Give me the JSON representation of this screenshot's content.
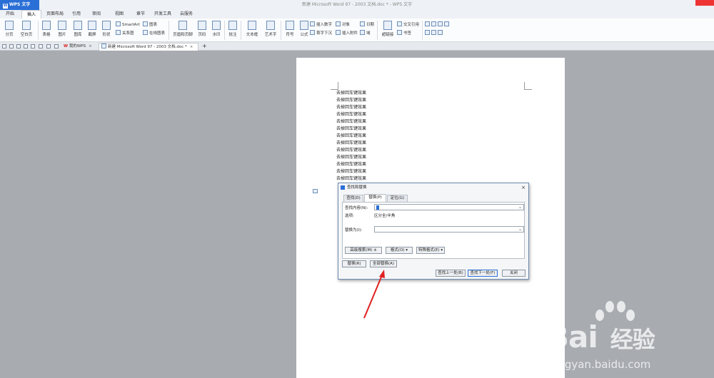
{
  "title_bar": {
    "app_label": "WPS 文字",
    "document_title": "新建 Microsoft Word 97 - 2003 文档.doc * - WPS 文字"
  },
  "menu_tabs": [
    "开始",
    "插入",
    "页面布局",
    "引用",
    "审阅",
    "视图",
    "章节",
    "开发工具",
    "云服务"
  ],
  "active_menu_tab": "插入",
  "ribbon": {
    "page_break": "分页",
    "blank_page": "空白页",
    "table": "表格",
    "picture": "图片",
    "gallery": "图库",
    "screenshot": "截屏",
    "shape": "形状",
    "smartart": "SmartArt",
    "chart": "图表",
    "relation_graph": "关系图",
    "online_chart": "在线图表",
    "header_footer": "页眉和页脚",
    "page_number": "页码",
    "watermark": "水印",
    "comment": "批注",
    "textbox": "文本框",
    "wordart": "艺术字",
    "symbol": "符号",
    "formula": "公式",
    "insert_number": "插入数字",
    "object": "对象",
    "drop_cap": "首字下沉",
    "attachment": "插入附件",
    "field": "域",
    "date": "日期",
    "hyperlink": "超链接",
    "cross_ref": "交叉引用",
    "bookmark": "书签"
  },
  "doc_tabs": {
    "my_wps": "我的WPS",
    "document": "新建 Microsoft Word 97 - 2003 文档.doc *",
    "close_glyph": "×",
    "add_glyph": "+"
  },
  "document": {
    "lines": [
      "去掉回车键效果",
      "去掉回车键效果",
      "去掉回车键效果",
      "去掉回车键效果",
      "去掉回车键效果",
      "去掉回车键效果",
      "去掉回车键效果",
      "去掉回车键效果",
      "去掉回车键效果",
      "去掉回车键效果",
      "去掉回车键效果",
      "去掉回车键效果",
      "去掉回车键效果"
    ]
  },
  "dialog": {
    "title": "查找和替换",
    "close_glyph": "×",
    "tabs": [
      "查找(D)",
      "替换(P)",
      "定位(G)"
    ],
    "active_tab": "替换(P)",
    "find_label": "查找内容(N):",
    "options_label": "选项:",
    "options_value": "区分全/半角",
    "replace_label": "替换为(I):",
    "advanced_search": "高级搜索(M) ±",
    "format": "格式(O) ▾",
    "special_format": "特殊格式(E) ▾",
    "replace_button": "替换(R)",
    "replace_all_button": "全部替换(A)",
    "find_prev_button": "查找上一处(B)",
    "find_next_button": "查找下一处(F)",
    "close_button": "关闭"
  },
  "watermark": {
    "brand": "Bai",
    "brand_cn": "经验",
    "url": "jingyan.baidu.com"
  },
  "colors": {
    "accent": "#2a6fd6",
    "annotation_arrow": "#e02020"
  }
}
